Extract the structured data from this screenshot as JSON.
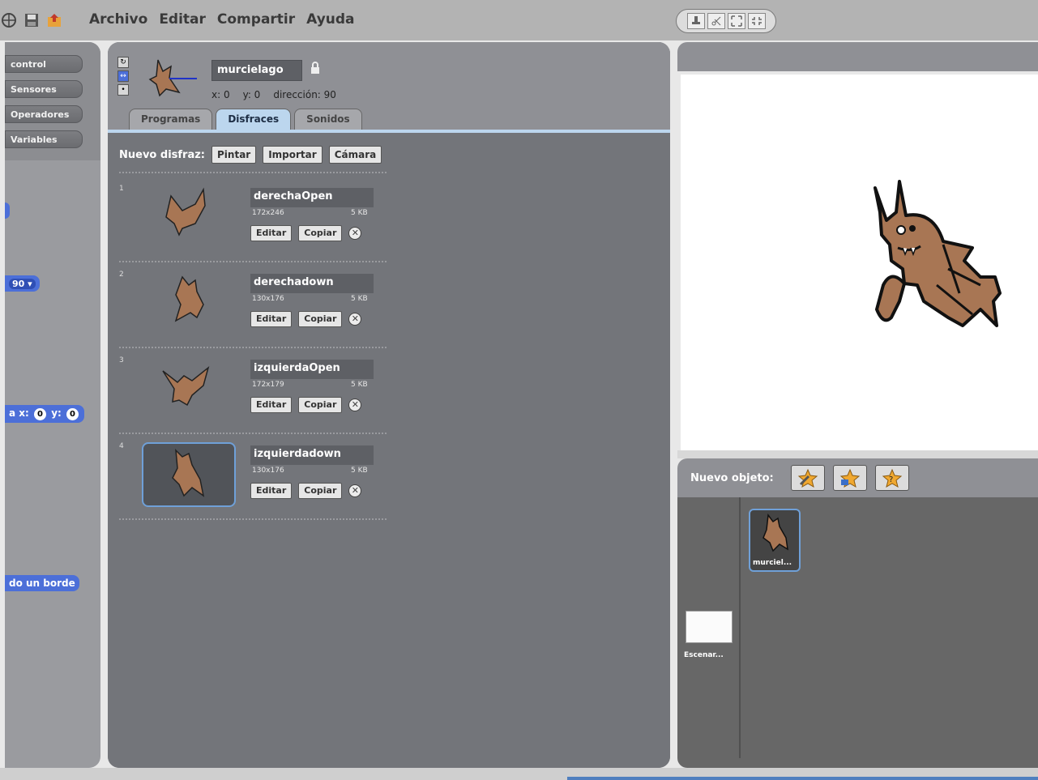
{
  "menubar": {
    "items": [
      "Archivo",
      "Editar",
      "Compartir",
      "Ayuda"
    ]
  },
  "palette": {
    "categories": [
      "control",
      "Sensores",
      "Operadores",
      "Variables"
    ],
    "blocks": {
      "dropdown_value": "90",
      "goto_prefix": "a x:",
      "goto_x": "0",
      "goto_y_label": "y:",
      "goto_y": "0",
      "edge_block": "do un borde"
    }
  },
  "sprite": {
    "name": "murcielago",
    "x_label": "x: 0",
    "y_label": "y: 0",
    "direction_label": "dirección: 90",
    "tabs": [
      "Programas",
      "Disfraces",
      "Sonidos"
    ],
    "active_tab": "Disfraces"
  },
  "costumes": {
    "new_label": "Nuevo disfraz:",
    "paint_label": "Pintar",
    "import_label": "Importar",
    "camera_label": "Cámara",
    "edit_label": "Editar",
    "copy_label": "Copiar",
    "items": [
      {
        "number": "1",
        "name": "derechaOpen",
        "dims": "172x246",
        "size": "5 KB"
      },
      {
        "number": "2",
        "name": "derechadown",
        "dims": "130x176",
        "size": "5 KB"
      },
      {
        "number": "3",
        "name": "izquierdaOpen",
        "dims": "172x179",
        "size": "5 KB"
      },
      {
        "number": "4",
        "name": "izquierdadown",
        "dims": "130x176",
        "size": "5 KB"
      }
    ],
    "selected_index": 3
  },
  "sprite_list": {
    "new_object_label": "Nuevo objeto:",
    "stage_label": "Escenar...",
    "sprite_label": "murciel..."
  },
  "colors": {
    "bat_fill": "#a87654",
    "block_blue": "#4c6fd8"
  }
}
